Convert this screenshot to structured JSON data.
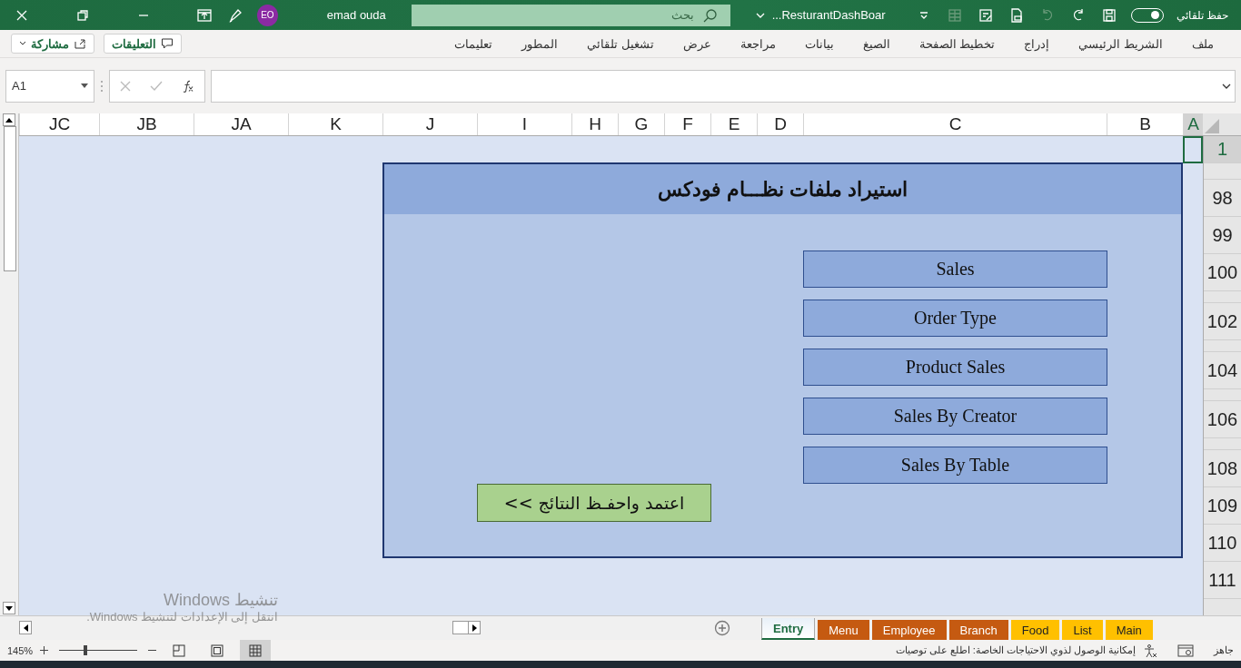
{
  "title_bar": {
    "autosave": {
      "label": "حفظ تلقائي",
      "on": true
    },
    "file_name": "ResturantDashBoar...",
    "search": {
      "placeholder": "بحث"
    },
    "user": {
      "initials": "EO",
      "name": "emad ouda"
    }
  },
  "ribbon_tabs": [
    "ملف",
    "الشريط الرئيسي",
    "إدراج",
    "تخطيط الصفحة",
    "الصيغ",
    "بيانات",
    "مراجعة",
    "عرض",
    "تشغيل تلقائي",
    "المطور",
    "تعليمات"
  ],
  "ribbon_buttons": {
    "comments": "التعليقات",
    "share": "مشاركة"
  },
  "formula_bar": {
    "name_box": "A1"
  },
  "columns": [
    {
      "label": "A",
      "selected": true
    },
    {
      "label": "B",
      "selected": false
    },
    {
      "label": "C",
      "selected": false
    },
    {
      "label": "D",
      "selected": false
    },
    {
      "label": "E",
      "selected": false
    },
    {
      "label": "F",
      "selected": false
    },
    {
      "label": "G",
      "selected": false
    },
    {
      "label": "H",
      "selected": false
    },
    {
      "label": "I",
      "selected": false
    },
    {
      "label": "J",
      "selected": false
    },
    {
      "label": "K",
      "selected": false
    },
    {
      "label": "JA",
      "selected": false
    },
    {
      "label": "JB",
      "selected": false
    },
    {
      "label": "JC",
      "selected": false
    }
  ],
  "rows": [
    {
      "label": "1",
      "selected": true
    },
    {
      "label": "98",
      "selected": false
    },
    {
      "label": "99",
      "selected": false
    },
    {
      "label": "100",
      "selected": false
    },
    {
      "label": "102",
      "selected": false
    },
    {
      "label": "104",
      "selected": false
    },
    {
      "label": "106",
      "selected": false
    },
    {
      "label": "108",
      "selected": false
    },
    {
      "label": "109",
      "selected": false
    },
    {
      "label": "110",
      "selected": false
    },
    {
      "label": "111",
      "selected": false
    }
  ],
  "panel": {
    "title": "استيراد ملفات نظـــام فودكس",
    "buttons": [
      "Sales",
      "Order Type",
      "Product Sales",
      "Sales By Creator",
      "Sales By Table"
    ],
    "submit": "اعتمد واحفـظ النتائج >>"
  },
  "activation_notice": {
    "title": "تنشيط Windows",
    "text": "انتقل إلى الإعدادات لتنشيط Windows."
  },
  "sheet_tabs": [
    {
      "label": "Main",
      "selected": false,
      "color": "#ffc000"
    },
    {
      "label": "List",
      "selected": false,
      "color": "#ffc000"
    },
    {
      "label": "Food",
      "selected": false,
      "color": "#ffc000"
    },
    {
      "label": "Branch",
      "selected": false,
      "color": "#c55a11"
    },
    {
      "label": "Employee",
      "selected": false,
      "color": "#c55a11"
    },
    {
      "label": "Menu",
      "selected": false,
      "color": "#c55a11"
    },
    {
      "label": "Entry",
      "selected": true,
      "color": "#ffffff"
    }
  ],
  "status_bar": {
    "ready": "جاهز",
    "accessibility": "إمكانية الوصول لذوي الاحتياجات الخاصة: اطلع على توصيات",
    "zoom": "145%",
    "zoom_slider": {
      "level": 0.33
    },
    "views": [
      {
        "kind": "normal",
        "selected": true
      },
      {
        "kind": "layout",
        "selected": false
      },
      {
        "kind": "break",
        "selected": false
      }
    ]
  }
}
